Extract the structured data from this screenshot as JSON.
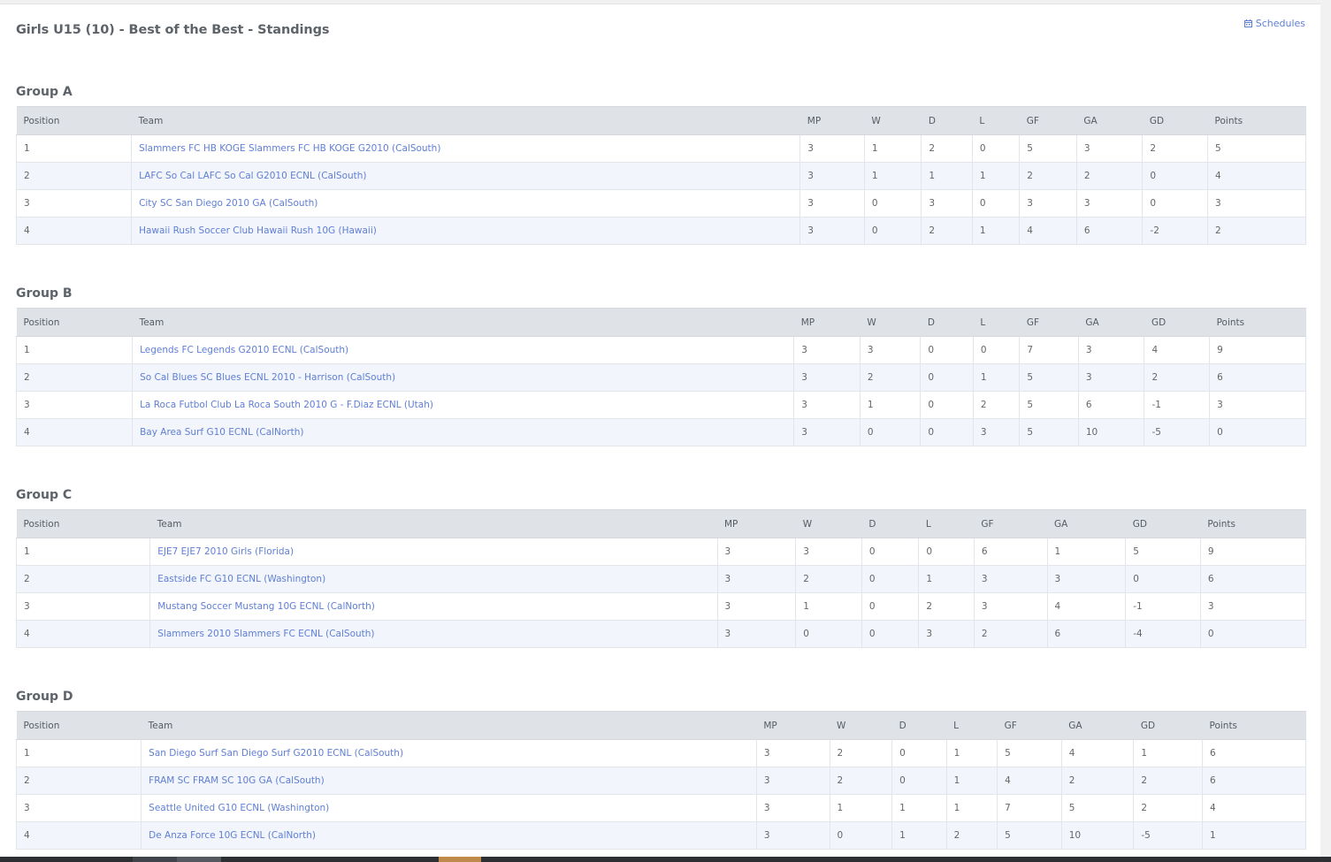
{
  "page": {
    "title": "Girls U15 (10) - Best of the Best - Standings",
    "schedules_label": "Schedules"
  },
  "columns": [
    "Position",
    "Team",
    "MP",
    "W",
    "D",
    "L",
    "GF",
    "GA",
    "GD",
    "Points"
  ],
  "groups": [
    {
      "name": "Group A",
      "rows": [
        {
          "position": "1",
          "team": "Slammers FC HB KOGE Slammers FC HB KOGE G2010 (CalSouth)",
          "mp": "3",
          "w": "1",
          "d": "2",
          "l": "0",
          "gf": "5",
          "ga": "3",
          "gd": "2",
          "points": "5"
        },
        {
          "position": "2",
          "team": "LAFC So Cal LAFC So Cal G2010 ECNL (CalSouth)",
          "mp": "3",
          "w": "1",
          "d": "1",
          "l": "1",
          "gf": "2",
          "ga": "2",
          "gd": "0",
          "points": "4"
        },
        {
          "position": "3",
          "team": "City SC San Diego 2010 GA (CalSouth)",
          "mp": "3",
          "w": "0",
          "d": "3",
          "l": "0",
          "gf": "3",
          "ga": "3",
          "gd": "0",
          "points": "3"
        },
        {
          "position": "4",
          "team": "Hawaii Rush Soccer Club Hawaii Rush 10G (Hawaii)",
          "mp": "3",
          "w": "0",
          "d": "2",
          "l": "1",
          "gf": "4",
          "ga": "6",
          "gd": "-2",
          "points": "2"
        }
      ]
    },
    {
      "name": "Group B",
      "rows": [
        {
          "position": "1",
          "team": "Legends FC Legends G2010 ECNL (CalSouth)",
          "mp": "3",
          "w": "3",
          "d": "0",
          "l": "0",
          "gf": "7",
          "ga": "3",
          "gd": "4",
          "points": "9"
        },
        {
          "position": "2",
          "team": "So Cal Blues SC Blues ECNL 2010 - Harrison (CalSouth)",
          "mp": "3",
          "w": "2",
          "d": "0",
          "l": "1",
          "gf": "5",
          "ga": "3",
          "gd": "2",
          "points": "6"
        },
        {
          "position": "3",
          "team": "La Roca Futbol Club La Roca South 2010 G - F.Diaz ECNL (Utah)",
          "mp": "3",
          "w": "1",
          "d": "0",
          "l": "2",
          "gf": "5",
          "ga": "6",
          "gd": "-1",
          "points": "3"
        },
        {
          "position": "4",
          "team": "Bay Area Surf G10 ECNL (CalNorth)",
          "mp": "3",
          "w": "0",
          "d": "0",
          "l": "3",
          "gf": "5",
          "ga": "10",
          "gd": "-5",
          "points": "0"
        }
      ]
    },
    {
      "name": "Group C",
      "rows": [
        {
          "position": "1",
          "team": "EJE7 EJE7 2010 Girls (Florida)",
          "mp": "3",
          "w": "3",
          "d": "0",
          "l": "0",
          "gf": "6",
          "ga": "1",
          "gd": "5",
          "points": "9"
        },
        {
          "position": "2",
          "team": "Eastside FC G10 ECNL (Washington)",
          "mp": "3",
          "w": "2",
          "d": "0",
          "l": "1",
          "gf": "3",
          "ga": "3",
          "gd": "0",
          "points": "6"
        },
        {
          "position": "3",
          "team": "Mustang Soccer Mustang 10G ECNL (CalNorth)",
          "mp": "3",
          "w": "1",
          "d": "0",
          "l": "2",
          "gf": "3",
          "ga": "4",
          "gd": "-1",
          "points": "3"
        },
        {
          "position": "4",
          "team": "Slammers 2010 Slammers FC ECNL (CalSouth)",
          "mp": "3",
          "w": "0",
          "d": "0",
          "l": "3",
          "gf": "2",
          "ga": "6",
          "gd": "-4",
          "points": "0"
        }
      ]
    },
    {
      "name": "Group D",
      "rows": [
        {
          "position": "1",
          "team": "San Diego Surf San Diego Surf G2010 ECNL (CalSouth)",
          "mp": "3",
          "w": "2",
          "d": "0",
          "l": "1",
          "gf": "5",
          "ga": "4",
          "gd": "1",
          "points": "6"
        },
        {
          "position": "2",
          "team": "FRAM SC FRAM SC 10G GA (CalSouth)",
          "mp": "3",
          "w": "2",
          "d": "0",
          "l": "1",
          "gf": "4",
          "ga": "2",
          "gd": "2",
          "points": "6"
        },
        {
          "position": "3",
          "team": "Seattle United G10 ECNL (Washington)",
          "mp": "3",
          "w": "1",
          "d": "1",
          "l": "1",
          "gf": "7",
          "ga": "5",
          "gd": "2",
          "points": "4"
        },
        {
          "position": "4",
          "team": "De Anza Force 10G ECNL (CalNorth)",
          "mp": "3",
          "w": "0",
          "d": "1",
          "l": "2",
          "gf": "5",
          "ga": "10",
          "gd": "-5",
          "points": "1"
        }
      ]
    }
  ],
  "icons": {
    "schedules": "calendar-icon"
  },
  "colors": {
    "link": "#5f7fd6",
    "header_bg": "#dfe3e8",
    "stripe_bg": "#f2f5fb"
  }
}
